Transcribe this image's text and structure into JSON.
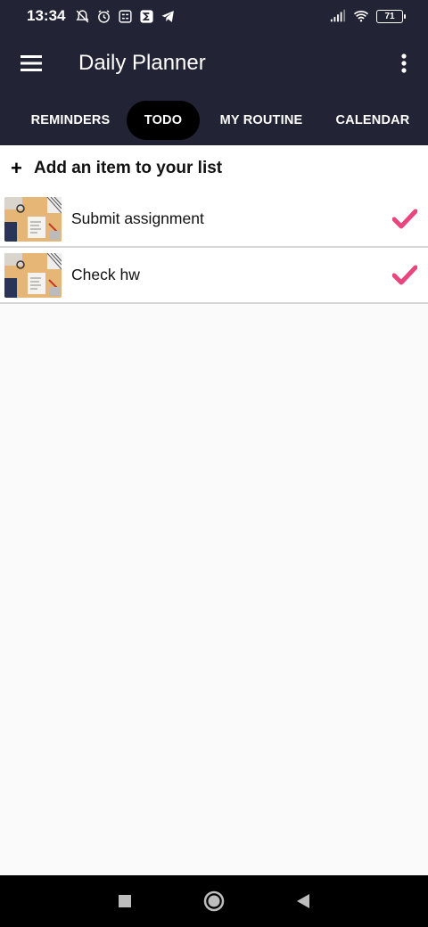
{
  "status_bar": {
    "time": "13:34",
    "battery": "71",
    "icons": [
      "notifications-off-icon",
      "alarm-icon",
      "app-icon",
      "sigma-app-icon",
      "telegram-icon",
      "signal-icon",
      "wifi-icon",
      "battery-icon"
    ]
  },
  "app_bar": {
    "title": "Daily Planner",
    "menu_icon": "hamburger-menu-icon",
    "more_icon": "more-vertical-icon"
  },
  "tabs": [
    {
      "label": "REMINDERS",
      "active": false
    },
    {
      "label": "TODO",
      "active": true
    },
    {
      "label": "MY ROUTINE",
      "active": false
    },
    {
      "label": "CALENDAR",
      "active": false
    }
  ],
  "add_item": {
    "icon": "+",
    "label": "Add an item to your list"
  },
  "todo_items": [
    {
      "label": "Submit assignment",
      "checked": true
    },
    {
      "label": "Check hw",
      "checked": true
    }
  ],
  "colors": {
    "bar_background": "#222436",
    "active_tab": "#000000",
    "check_color": "#e8467c"
  },
  "nav_bar": {
    "buttons": [
      "recents-square-icon",
      "home-circle-icon",
      "back-triangle-icon"
    ]
  }
}
